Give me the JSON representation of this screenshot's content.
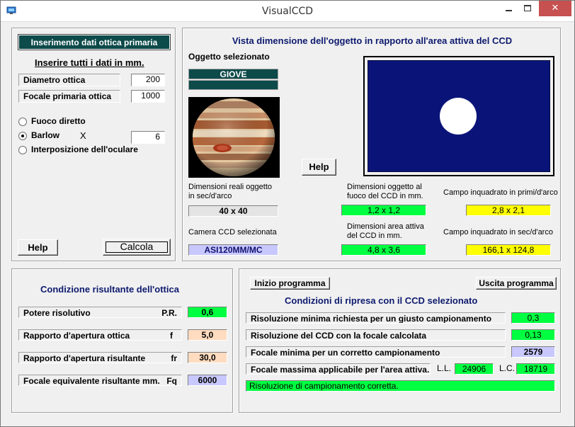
{
  "window": {
    "title": "VisualCCD",
    "close_glyph": "✕"
  },
  "left_panel": {
    "header": "Inserimento dati ottica primaria",
    "subtitle": "Inserire tutti i dati in mm.",
    "diameter_label": "Diametro ottica",
    "diameter_value": "200",
    "focal_label": "Focale primaria ottica",
    "focal_value": "1000",
    "radio_direct": "Fuoco diretto",
    "radio_barlow": "Barlow",
    "barlow_x": "X",
    "barlow_value": "6",
    "radio_eyepiece": "Interposizione dell'oculare",
    "help_button": "Help",
    "calc_button": "Calcola"
  },
  "view_panel": {
    "title": "Vista  dimensione dell'oggetto in rapporto all'area attiva del CCD",
    "object_label": "Oggetto selezionato",
    "object_name": "GIOVE",
    "object_extra": "",
    "help_button": "Help",
    "real_dim_label_1": "Dimensioni reali oggetto",
    "real_dim_label_2": "in sec/d'arco",
    "real_dim_value": "40 x 40",
    "camera_label": "Camera CCD selezionata",
    "camera_value": "ASI120MM/MC",
    "obj_ccd_label_1": "Dimensioni oggetto al",
    "obj_ccd_label_2": "fuoco del CCD in mm.",
    "obj_ccd_value": "1,2 x 1,2",
    "ccd_area_label_1": "Dimensioni area attiva",
    "ccd_area_label_2": "del CCD in mm.",
    "ccd_area_value": "4,8 x 3,6",
    "field_arcmin_label": "Campo inquadrato in primi/d'arco",
    "field_arcmin_value": "2,8 x 2,1",
    "field_arcsec_label": "Campo inquadrato in sec/d'arco",
    "field_arcsec_value": "166,1 x 124,8",
    "ccd_color": "#0a1478",
    "object_color": "#ffffff"
  },
  "optics_panel": {
    "title": "Condizione risultante dell'ottica",
    "rows": [
      {
        "label": "Potere risolutivo",
        "symbol": "P.R.",
        "value": "0,6"
      },
      {
        "label": "Rapporto d'apertura ottica",
        "symbol": "f",
        "value": "5,0"
      },
      {
        "label": "Rapporto d'apertura risultante",
        "symbol": "fr",
        "value": "30,0"
      },
      {
        "label": "Focale equivalente risultante  mm.",
        "symbol": "Fq",
        "value": "6000"
      }
    ]
  },
  "ccd_panel": {
    "start_button": "Inizio  programma",
    "exit_button": "Uscita programma",
    "title": "Condizioni  di  ripresa  con  il  CCD  selezionato",
    "rows": [
      {
        "label": "Risoluzione minima richiesta per un giusto campionamento",
        "value": "0,3"
      },
      {
        "label": "Risoluzione del CCD con la focale calcolata",
        "value": "0,13"
      },
      {
        "label": "Focale minima per un corretto campionamento",
        "value": "2579"
      }
    ],
    "max_focal_label": "Focale massima applicabile per l'area attiva.",
    "ll_label": "L.L.",
    "ll_value": "24906",
    "lc_label": "L.C.",
    "lc_value": "18719",
    "status_message": "Risoluzione di campionamento corretta."
  }
}
